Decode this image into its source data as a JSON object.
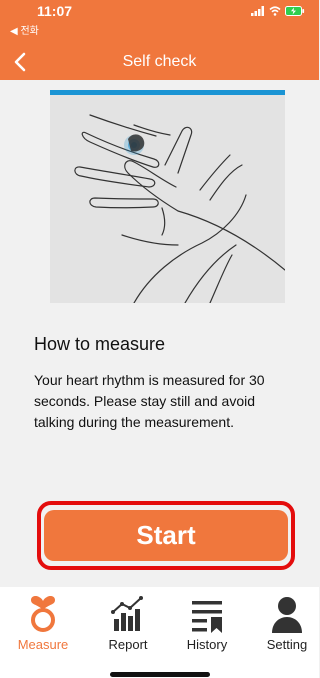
{
  "status_bar": {
    "time": "11:07",
    "back_to_app": "◀ 전화",
    "icons": [
      "signal-icon",
      "wifi-icon",
      "battery-charging-icon"
    ]
  },
  "header": {
    "title": "Self check",
    "back_icon": "chevron-left-icon"
  },
  "instructions": {
    "image": "finger-on-sensor-illustration",
    "heading": "How to measure",
    "body": "Your heart rhythm is measured for 30 seconds. Please stay still and avoid talking during the measurement."
  },
  "start_button": {
    "label": "Start"
  },
  "tabs": [
    {
      "label": "Measure",
      "icon": "heart-ring-icon",
      "active": true
    },
    {
      "label": "Report",
      "icon": "bar-chart-icon",
      "active": false
    },
    {
      "label": "History",
      "icon": "list-bookmark-icon",
      "active": false
    },
    {
      "label": "Setting",
      "icon": "person-icon",
      "active": false
    }
  ],
  "colors": {
    "brand_orange": "#f0773d",
    "highlight_red": "#e40d0d",
    "illustration_accent": "#1b94d4",
    "background": "#f1f1f1"
  }
}
